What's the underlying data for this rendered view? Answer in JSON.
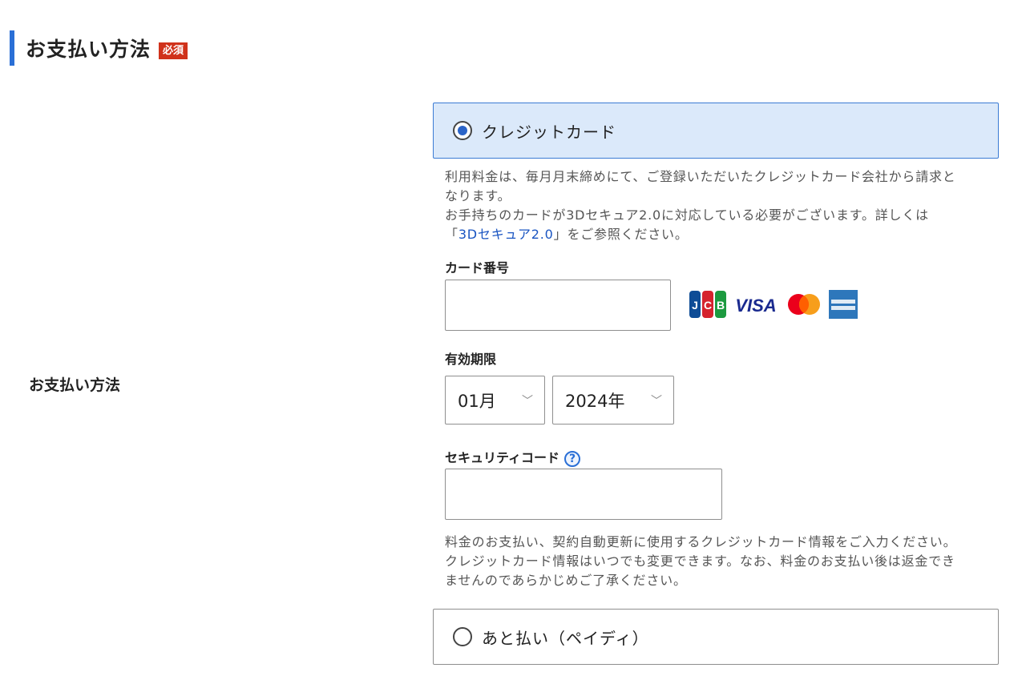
{
  "section": {
    "title": "お支払い方法",
    "required_badge": "必須"
  },
  "row_label": "お支払い方法",
  "credit_option": {
    "label": "クレジットカード",
    "selected": true
  },
  "credit_desc": {
    "line1": "利用料金は、毎月月末締めにて、ご登録いただいたクレジットカード会社から請求と",
    "line2": "なります。",
    "line3": "お手持ちのカードが3Dセキュア2.0に対応している必要がございます。詳しくは",
    "line4_prefix": "「",
    "line4_link": "3Dセキュア2.0",
    "line4_suffix": "」をご参照ください。"
  },
  "card_number": {
    "label": "カード番号",
    "value": ""
  },
  "card_brands": [
    "JCB",
    "VISA",
    "Mastercard",
    "American Express"
  ],
  "expiry": {
    "label": "有効期限",
    "month": "01月",
    "year": "2024年"
  },
  "security_code": {
    "label": "セキュリティコード",
    "help": "?",
    "value": ""
  },
  "notice": {
    "line1": "料金のお支払い、契約自動更新に使用するクレジットカード情報をご入力ください。",
    "line2": "クレジットカード情報はいつでも変更できます。なお、料金のお支払い後は返金でき",
    "line3": "ませんのであらかじめご了承ください。"
  },
  "other_option": {
    "label": "あと払い（ペイディ）",
    "selected": false
  },
  "colors": {
    "accent": "#2a6fd6",
    "badge": "#d0321b",
    "selected_bg": "#dbe9fa"
  }
}
